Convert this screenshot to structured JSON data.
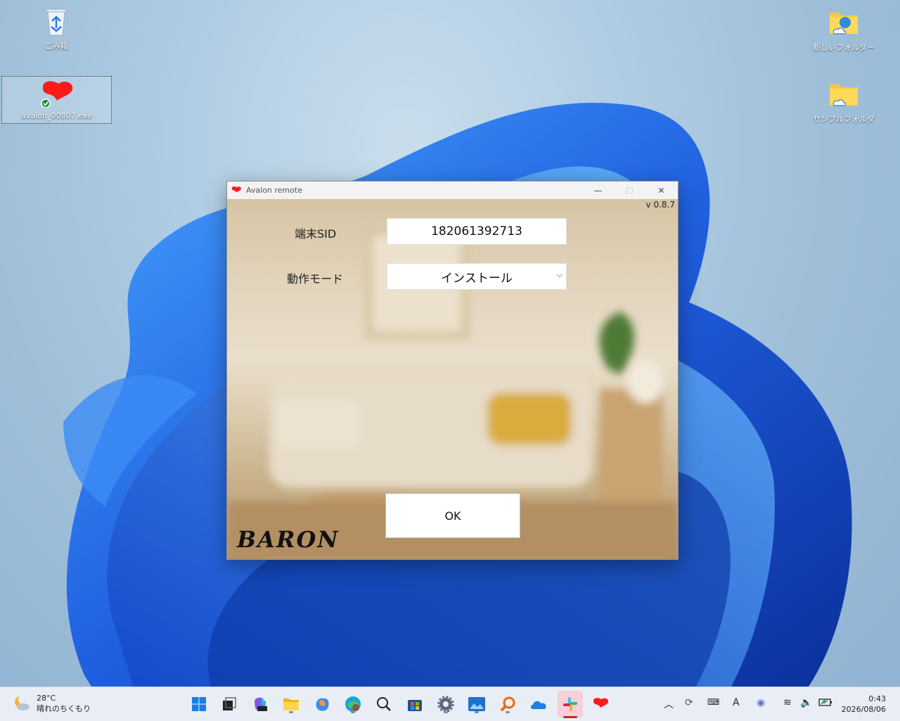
{
  "desktop": {
    "icons": [
      {
        "label": "ごみ箱",
        "icon": "recycle-bin-icon"
      },
      {
        "label": "avalon_00807.exe",
        "icon": "avalon-app-icon"
      },
      {
        "label": "新しいフォルダー",
        "icon": "folder-icon"
      },
      {
        "label": "サンプルフォルダ",
        "icon": "folder-icon"
      }
    ]
  },
  "window": {
    "title": "Avalon remote",
    "minimize": "—",
    "maximize": "☐",
    "close": "✕",
    "version": "v 0.8.7",
    "sid_label": "端末SID",
    "sid_value": "182061392713",
    "mode_label": "動作モード",
    "mode_value": "インストール",
    "ok_label": "OK",
    "brand": "BARON"
  },
  "taskbar": {
    "weather_temp": "28°C",
    "weather_desc": "晴れのちくもり",
    "apps": [
      "start-icon",
      "task-view-icon",
      "m365-icon",
      "file-explorer-icon",
      "copilot-icon",
      "edge-icon",
      "search-icon",
      "store-icon",
      "settings-icon",
      "photos-icon",
      "search-tool-icon",
      "onedrive-icon",
      "slack-icon",
      "avalon-app-icon"
    ],
    "tray_ime": "A",
    "clock_time": "0:43",
    "clock_date": "2026/08/06"
  },
  "colors": {
    "accent_red": "#ff1a1a",
    "taskbar_bg": "#e9eef6",
    "bloom_blue": "#1f5fe0"
  }
}
